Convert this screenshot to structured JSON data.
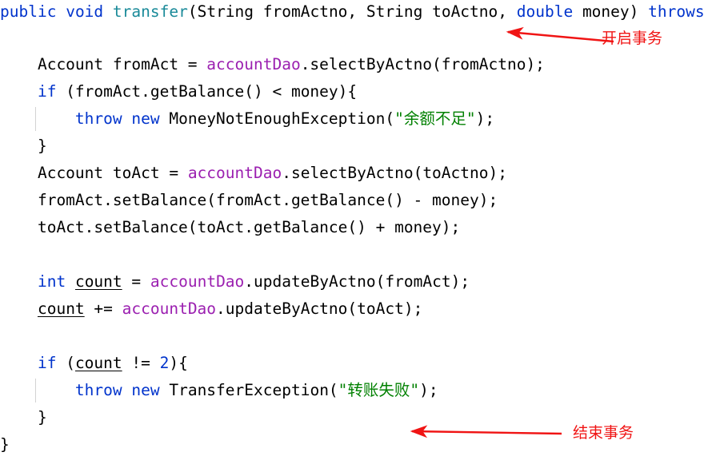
{
  "editor": {
    "language": "java",
    "background": "#ffffff",
    "colors": {
      "keyword": "#0033cc",
      "method_declaration": "#1a8a99",
      "field_reference": "#9b1fb0",
      "string_literal": "#008000",
      "number_literal": "#0033cc",
      "plain_text": "#000000",
      "indent_guide": "#d2d2d2",
      "annotation_red": "#f01414"
    }
  },
  "code": {
    "line_01": {
      "t1": "public",
      "t2": " ",
      "t3": "void",
      "t4": " ",
      "t5": "transfer",
      "t6": "(String fromActno, String toActno, ",
      "t7": "double",
      "t8": " money) ",
      "t9": "throws"
    },
    "line_02": "",
    "line_03": {
      "t1": "    Account fromAct = ",
      "t2": "accountDao",
      "t3": ".selectByActno(fromActno);"
    },
    "line_04": {
      "t1": "    ",
      "t2": "if",
      "t3": " (fromAct.getBalance() < money){"
    },
    "line_05": {
      "t1": "        ",
      "t2": "throw",
      "t3": " ",
      "t4": "new",
      "t5": " MoneyNotEnoughException(",
      "t6": "\"余额不足\"",
      "t7": ");"
    },
    "line_06": "    }",
    "line_07": {
      "t1": "    Account toAct = ",
      "t2": "accountDao",
      "t3": ".selectByActno(toActno);"
    },
    "line_08": "    fromAct.setBalance(fromAct.getBalance() - money);",
    "line_09": "    toAct.setBalance(toAct.getBalance() + money);",
    "line_10": "",
    "line_11": {
      "t1": "    ",
      "t2": "int",
      "t3": " ",
      "t4": "count",
      "t5": " = ",
      "t6": "accountDao",
      "t7": ".updateByActno(fromAct);"
    },
    "line_12": {
      "t1": "    ",
      "t2": "count",
      "t3": " += ",
      "t4": "accountDao",
      "t5": ".updateByActno(toAct);"
    },
    "line_13": "",
    "line_14": {
      "t1": "    ",
      "t2": "if",
      "t3": " (",
      "t4": "count",
      "t5": " != ",
      "t6": "2",
      "t7": "){"
    },
    "line_15": {
      "t1": "        ",
      "t2": "throw",
      "t3": " ",
      "t4": "new",
      "t5": " TransferException(",
      "t6": "\"转账失败\"",
      "t7": ");"
    },
    "line_16": "    }",
    "line_17": "}"
  },
  "annotations": {
    "begin_transaction": {
      "label": "开启事务",
      "color": "#f01414",
      "arrow": "left-arrow"
    },
    "end_transaction": {
      "label": "结束事务",
      "color": "#f01414",
      "arrow": "left-arrow"
    }
  }
}
